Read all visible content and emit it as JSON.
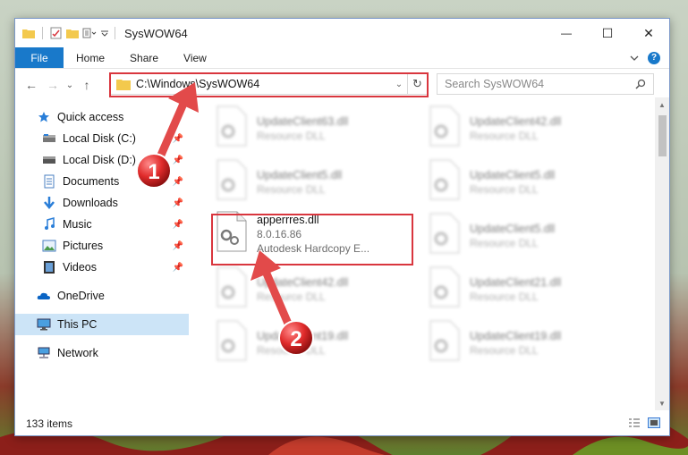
{
  "window": {
    "title": "SysWOW64",
    "controls": {
      "minimize": "—",
      "maximize": "☐",
      "close": "✕"
    }
  },
  "ribbon": {
    "tabs": [
      "File",
      "Home",
      "Share",
      "View"
    ]
  },
  "navbar": {
    "back": "←",
    "forward": "→",
    "recent": "⌄",
    "up": "↑",
    "address": "C:\\Windows\\SysWOW64",
    "refresh": "↻",
    "search_placeholder": "Search SysWOW64"
  },
  "sidebar": {
    "items": [
      {
        "label": "Quick access",
        "icon": "star-icon",
        "pinned": false
      },
      {
        "label": "Local Disk (C:)",
        "icon": "drive-icon",
        "pinned": true
      },
      {
        "label": "Local Disk (D:)",
        "icon": "drive-icon",
        "pinned": true
      },
      {
        "label": "Documents",
        "icon": "documents-icon",
        "pinned": true
      },
      {
        "label": "Downloads",
        "icon": "downloads-icon",
        "pinned": true
      },
      {
        "label": "Music",
        "icon": "music-icon",
        "pinned": true
      },
      {
        "label": "Pictures",
        "icon": "pictures-icon",
        "pinned": true
      },
      {
        "label": "Videos",
        "icon": "videos-icon",
        "pinned": true
      },
      {
        "label": "OneDrive",
        "icon": "onedrive-icon",
        "pinned": false
      },
      {
        "label": "This PC",
        "icon": "this-pc-icon",
        "pinned": false,
        "selected": true
      },
      {
        "label": "Network",
        "icon": "network-icon",
        "pinned": false
      }
    ]
  },
  "files": {
    "left": [
      {
        "name": "UpdateClient63.dll",
        "sub": "Resource DLL",
        "blurred": true
      },
      {
        "name": "UpdateClient5.dll",
        "sub": "Resource DLL",
        "blurred": true
      },
      {
        "name": "apperrres.dll",
        "version": "8.0.16.86",
        "sub": "Autodesk Hardcopy E...",
        "blurred": false
      },
      {
        "name": "UpdateClient42.dll",
        "sub": "Resource DLL",
        "blurred": true
      },
      {
        "name": "UpdateClient19.dll",
        "sub": "Resource DLL",
        "blurred": true
      }
    ],
    "right": [
      {
        "name": "UpdateClient42.dll",
        "sub": "Resource DLL"
      },
      {
        "name": "UpdateClient5.dll",
        "sub": "Resource DLL"
      },
      {
        "name": "UpdateClient5.dll",
        "sub": "Resource DLL"
      },
      {
        "name": "UpdateClient21.dll",
        "sub": "Resource DLL"
      },
      {
        "name": "UpdateClient19.dll",
        "sub": "Resource DLL"
      }
    ]
  },
  "status": {
    "item_count": "133 items"
  },
  "annotations": {
    "step1": "1",
    "step2": "2"
  },
  "colors": {
    "accent": "#1979ca",
    "highlight": "#d9363e",
    "selected": "#cce4f7"
  }
}
